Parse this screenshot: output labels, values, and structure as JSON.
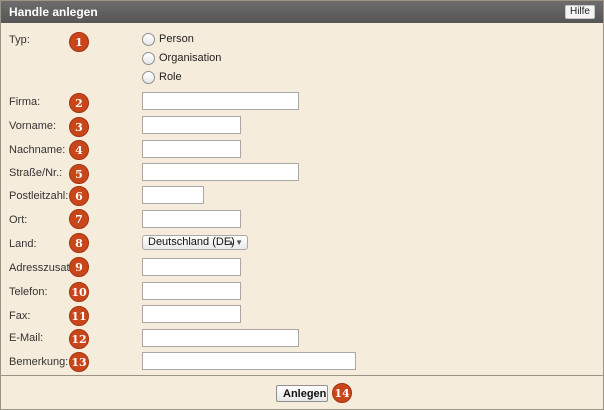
{
  "window": {
    "title": "Handle anlegen",
    "help_label": "Hilfe"
  },
  "fields": {
    "type_label": "Typ:",
    "type_options": [
      "Person",
      "Organisation",
      "Role"
    ],
    "company_label": "Firma:",
    "firstname_label": "Vorname:",
    "lastname_label": "Nachname:",
    "street_label": "Straße/Nr.:",
    "postcode_label": "Postleitzahl:",
    "city_label": "Ort:",
    "country_label": "Land:",
    "country_selected": "Deutschland (DE)",
    "address_extra_label": "Adresszusatz:",
    "phone_label": "Telefon:",
    "fax_label": "Fax:",
    "email_label": "E-Mail:",
    "remarks_label": "Bemerkung:"
  },
  "markers": [
    "1",
    "2",
    "3",
    "4",
    "5",
    "6",
    "7",
    "8",
    "9",
    "10",
    "11",
    "12",
    "13",
    "14"
  ],
  "footer": {
    "submit_label": "Anlegen"
  }
}
